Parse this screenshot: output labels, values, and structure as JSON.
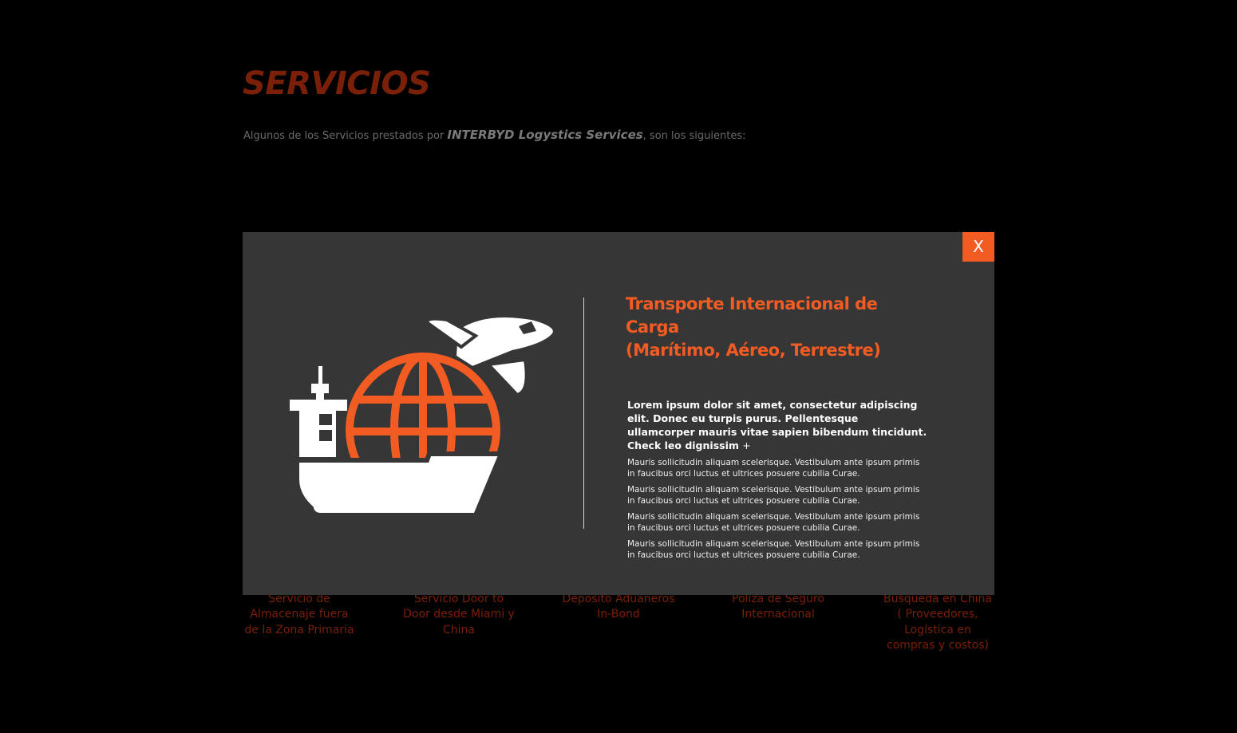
{
  "page": {
    "title": "SERVICIOS",
    "intro_before": "Algunos de los Servicios prestados por ",
    "intro_brand": "INTERBYD Logystics Services",
    "intro_after": ", son los siguientes:"
  },
  "services": [
    {
      "label": "Servicio de Almacenaje fuera de la Zona Primaria"
    },
    {
      "label": "Servicio Door to Door desde Miami y China"
    },
    {
      "label": "Depósito Aduaneros In-Bond"
    },
    {
      "label": "Póliza de Seguro Internacional"
    },
    {
      "label": "Búsqueda  en China ( Proveedores, Logística en compras y costos)"
    }
  ],
  "modal": {
    "close_label": "X",
    "title_line1": "Transporte Internacional de Carga",
    "title_line2": "(Marítimo, Aéreo, Terrestre)",
    "lead": "Lorem ipsum dolor sit amet, consectetur adipiscing elit. Donec eu turpis purus. Pellentesque ullamcorper mauris vitae sapien bibendum tincidunt. Check leo dignissim",
    "lead_more": "+",
    "details": [
      "Mauris sollicitudin aliquam scelerisque. Vestibulum ante ipsum primis in faucibus orci luctus et ultrices posuere cubilia Curae.",
      "Mauris sollicitudin aliquam scelerisque. Vestibulum ante ipsum primis in faucibus orci luctus et ultrices posuere cubilia Curae.",
      "Mauris sollicitudin aliquam scelerisque. Vestibulum ante ipsum primis in faucibus orci luctus et ultrices posuere cubilia Curae.",
      "Mauris sollicitudin aliquam scelerisque. Vestibulum ante ipsum primis in faucibus orci luctus et ultrices posuere cubilia Curae."
    ],
    "illustration_icon": "ship-globe-plane-icon"
  },
  "colors": {
    "accent": "#f25c23",
    "title_dim": "#7a1f08",
    "modal_bg": "#363636",
    "page_bg": "#000000"
  }
}
